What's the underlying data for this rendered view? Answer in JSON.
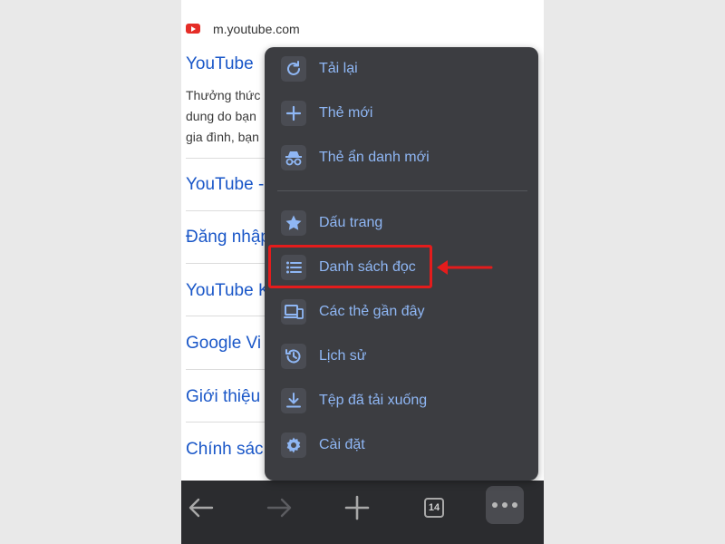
{
  "browser": {
    "url": "m.youtube.com",
    "icons": [
      "youtube-favicon",
      "back-arrow-icon",
      "forward-arrow-icon",
      "plus-icon",
      "tab-counter-icon",
      "more-icon"
    ],
    "tab_count": "14"
  },
  "results": [
    {
      "title": "YouTube"
    },
    {
      "title": "YouTube -"
    },
    {
      "title": "Đăng nhập"
    },
    {
      "title": "YouTube K"
    },
    {
      "title": "Google Vi"
    },
    {
      "title": "Giới thiệu"
    },
    {
      "title": "Chính sác"
    }
  ],
  "snippet": {
    "line1": "Thưởng thức",
    "line2": "dung do bạn",
    "line3": "gia đình, bạn"
  },
  "menu": {
    "items": [
      {
        "label": "Tải lại",
        "icon": "reload-icon"
      },
      {
        "label": "Thẻ mới",
        "icon": "plus-icon"
      },
      {
        "label": "Thẻ ẩn danh mới",
        "icon": "incognito-icon"
      },
      {
        "label": "Dấu trang",
        "icon": "star-icon"
      },
      {
        "label": "Danh sách đọc",
        "icon": "list-icon"
      },
      {
        "label": "Các thẻ gần đây",
        "icon": "devices-icon"
      },
      {
        "label": "Lịch sử",
        "icon": "history-icon"
      },
      {
        "label": "Tệp đã tải xuống",
        "icon": "download-icon"
      },
      {
        "label": "Cài đặt",
        "icon": "gear-icon"
      }
    ],
    "highlighted": "Danh sách đọc"
  },
  "colors": {
    "menu_bg": "#3c3d41",
    "menu_text": "#8fb7f5",
    "link": "#1a57c8",
    "highlight": "#e41c1c",
    "toolbar_bg": "#2b2c2f"
  }
}
